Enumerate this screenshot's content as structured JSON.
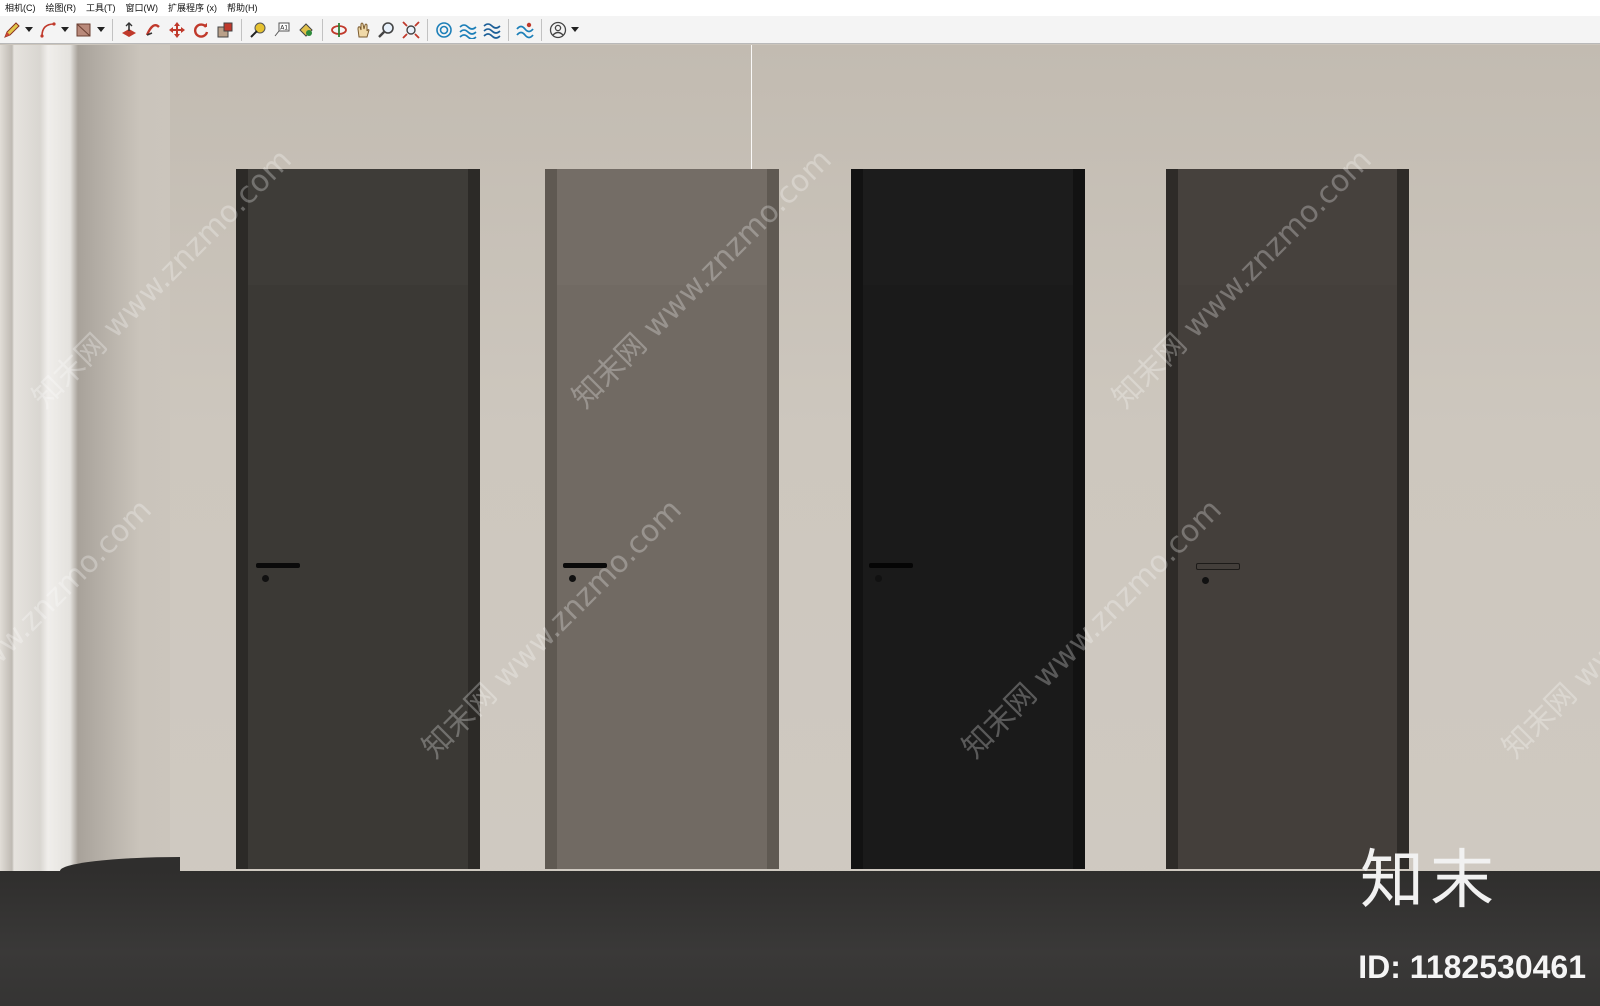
{
  "menubar": {
    "items": [
      "相机(C)",
      "绘图(R)",
      "工具(T)",
      "窗口(W)",
      "扩展程序 (x)",
      "帮助(H)"
    ]
  },
  "toolbar": {
    "groups": [
      [
        "pencil-icon",
        "arc-icon",
        "shape-icon"
      ],
      [
        "push-pull-icon",
        "follow-me-icon",
        "move-icon",
        "rotate-icon",
        "scale-icon"
      ],
      [
        "tape-measure-icon",
        "text-label-icon",
        "paint-bucket-icon"
      ],
      [
        "orbit-icon",
        "pan-icon",
        "zoom-icon",
        "zoom-extents-icon"
      ],
      [
        "sandbox-icon",
        "terrain-icon",
        "contours-icon",
        "smoove-icon"
      ],
      [
        "account-icon"
      ]
    ]
  },
  "scene": {
    "doors": [
      {
        "name": "door-1",
        "frame_color": "#2c2a27",
        "transom_color": "#3e3c38",
        "leaf_color": "#3b3935",
        "handle": "black-bar"
      },
      {
        "name": "door-2",
        "frame_color": "#5f5952",
        "transom_color": "#746d66",
        "leaf_color": "#716a63",
        "handle": "black-bar"
      },
      {
        "name": "door-3",
        "frame_color": "#121212",
        "transom_color": "#1c1c1c",
        "leaf_color": "#1a1a1a",
        "handle": "black-bar"
      },
      {
        "name": "door-4",
        "frame_color": "#2e2b28",
        "transom_color": "#46413d",
        "leaf_color": "#443f3b",
        "handle": "recessed"
      }
    ]
  },
  "watermark": {
    "text": "知末网 www.znzmo.com",
    "logo": "知末",
    "id_label": "ID: 1182530461"
  },
  "colors": {
    "wall": "#cbc5bc",
    "floor": "#353433",
    "toolbar_bg": "#f4f4f4"
  }
}
